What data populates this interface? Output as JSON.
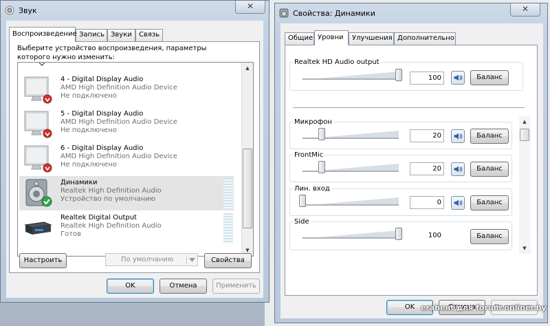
{
  "sound": {
    "title": "Звук",
    "tabs": [
      "Воспроизведение",
      "Запись",
      "Звуки",
      "Связь"
    ],
    "instruction": "Выберите устройство воспроизведения, параметры которого нужно изменить:",
    "devices": [
      {
        "name": "4 - Digital Display Audio",
        "driver": "AMD High Definition Audio Device",
        "status": "Не подключено"
      },
      {
        "name": "5 - Digital Display Audio",
        "driver": "AMD High Definition Audio Device",
        "status": "Не подключено"
      },
      {
        "name": "6 - Digital Display Audio",
        "driver": "AMD High Definition Audio Device",
        "status": "Не подключено"
      },
      {
        "name": "Динамики",
        "driver": "Realtek High Definition Audio",
        "status": "Устройство по умолчанию"
      },
      {
        "name": "Realtek Digital Output",
        "driver": "Realtek High Definition Audio",
        "status": "Готов"
      }
    ],
    "configure_label": "Настроить",
    "default_label": "По умолчанию",
    "properties_label": "Свойства",
    "ok_label": "OK",
    "cancel_label": "Отмена",
    "apply_label": "Применить",
    "close_glyph": "✕"
  },
  "props": {
    "title": "Свойства: Динамики",
    "tabs": [
      "Общие",
      "Уровни",
      "Улучшения",
      "Дополнительно"
    ],
    "master": {
      "label": "Realtek HD Audio output",
      "value": "100",
      "level": 1.0
    },
    "channels": [
      {
        "label": "Микрофон",
        "value": "20",
        "level": 0.2
      },
      {
        "label": "FrontMic",
        "value": "20",
        "level": 0.2
      },
      {
        "label": "Лин. вход",
        "value": "0",
        "level": 0.0
      },
      {
        "label": "Side",
        "value": "100",
        "level": 1.0
      }
    ],
    "balance_label": "Баланс",
    "ok_label": "OK",
    "cancel_label": "Отмена",
    "apply_label": "Применить",
    "close_glyph": "✕"
  },
  "watermark": "еraheнt для forum.onliner.by"
}
